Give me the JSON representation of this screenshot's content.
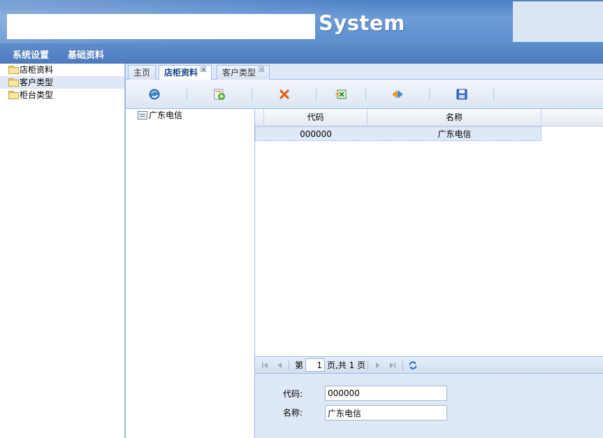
{
  "header": {
    "title": "System"
  },
  "menu": {
    "items": [
      "系统设置",
      "基础资料"
    ]
  },
  "sidebar": {
    "items": [
      {
        "label": "店柜资料"
      },
      {
        "label": "客户类型"
      },
      {
        "label": "柜台类型"
      }
    ]
  },
  "tabs": {
    "items": [
      {
        "label": "主页"
      },
      {
        "label": "店柜资料"
      },
      {
        "label": "客户类型"
      }
    ],
    "close_glyph": "×"
  },
  "toolbar": {
    "icons": [
      "refresh-icon",
      "add-icon",
      "delete-icon",
      "excel-export-icon",
      "edit-icon",
      "save-icon"
    ]
  },
  "org_tree": {
    "node_label": "广东电信"
  },
  "grid": {
    "columns": [
      "代码",
      "名称"
    ],
    "rows": [
      {
        "code": "000000",
        "name": "广东电信"
      }
    ]
  },
  "pager": {
    "page_prefix": "第",
    "current_page": "1",
    "page_suffix": "页,共 1 页"
  },
  "form": {
    "code_label": "代码:",
    "code_value": "000000",
    "name_label": "名称:",
    "name_value": "广东电信"
  },
  "colors": {
    "banner": "#5e8fcf",
    "menubar": "#4c7dbe",
    "selection": "#dfe8f6",
    "border": "#99bbe8"
  }
}
